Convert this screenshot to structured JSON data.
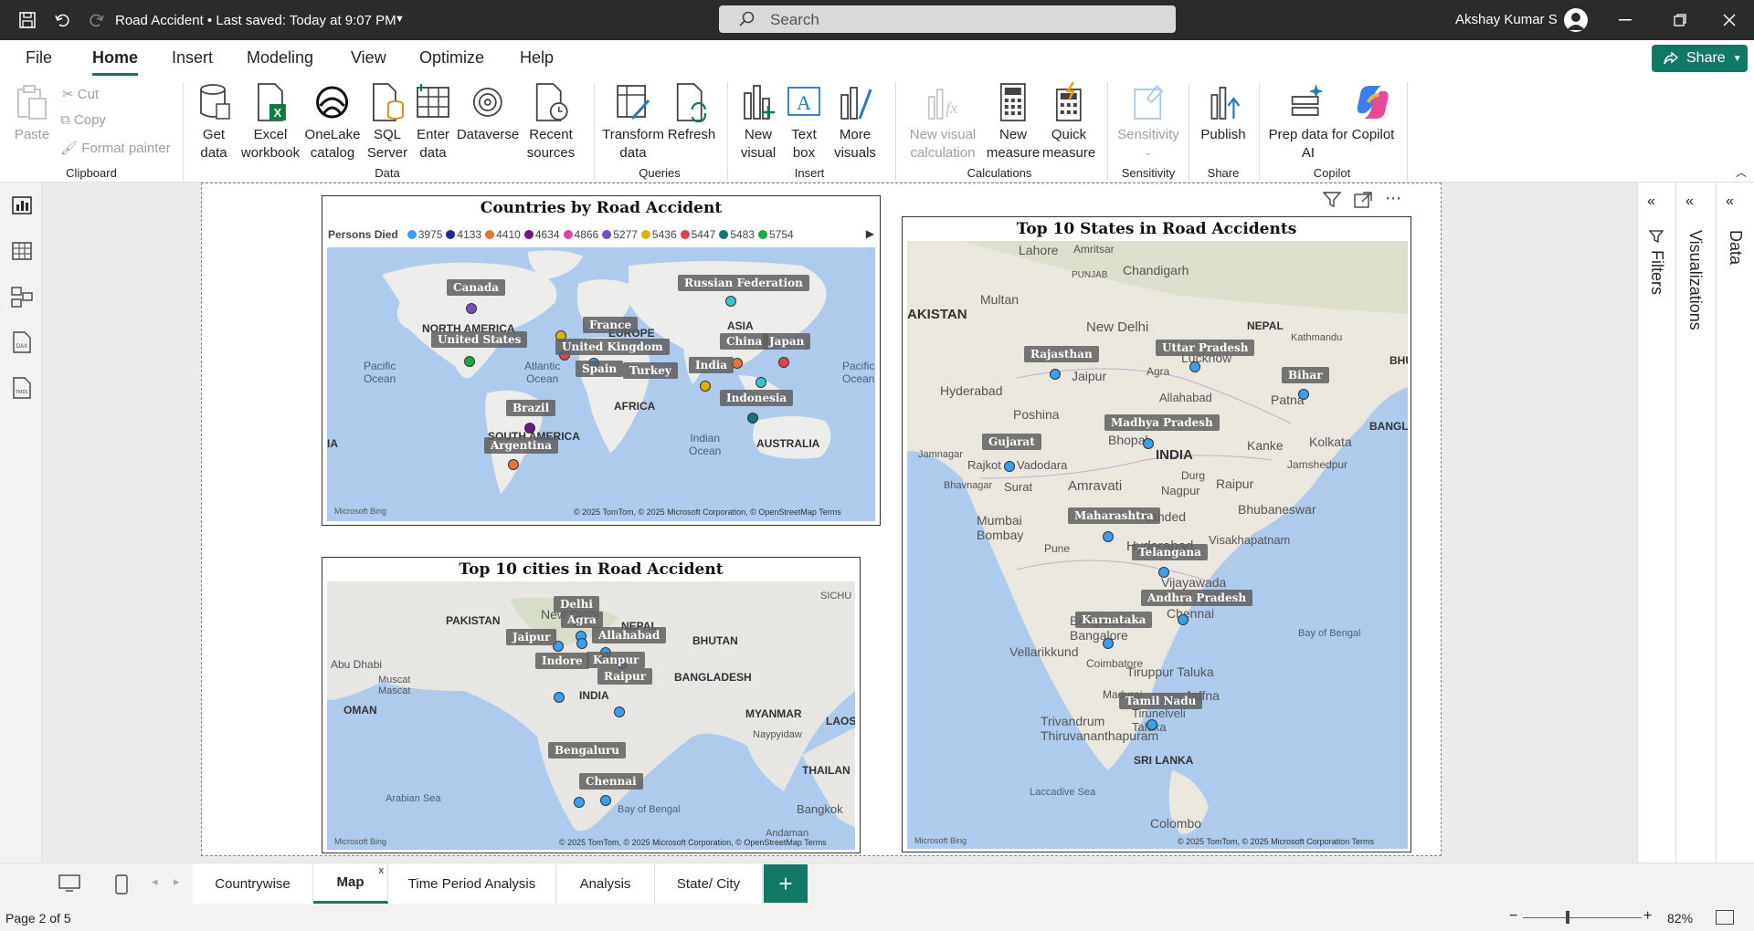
{
  "titlebar": {
    "doc_title": "Road Accident • Last saved: Today at 9:07 PM",
    "search_placeholder": "Search",
    "user_name": "Akshay Kumar S"
  },
  "menu": {
    "tabs": [
      "File",
      "Home",
      "Insert",
      "Modeling",
      "View",
      "Optimize",
      "Help"
    ],
    "active": "Home",
    "share_label": "Share"
  },
  "ribbon": {
    "clipboard": {
      "paste": "Paste",
      "cut": "Cut",
      "copy": "Copy",
      "format_painter": "Format painter",
      "group": "Clipboard"
    },
    "data": {
      "get_data": "Get\ndata",
      "excel": "Excel\nworkbook",
      "onelake": "OneLake\ncatalog",
      "sql": "SQL\nServer",
      "enter": "Enter\ndata",
      "dataverse": "Dataverse",
      "recent": "Recent\nsources",
      "group": "Data"
    },
    "queries": {
      "transform": "Transform\ndata",
      "refresh": "Refresh",
      "group": "Queries"
    },
    "insert": {
      "new_visual": "New\nvisual",
      "text_box": "Text\nbox",
      "more_visuals": "More\nvisuals",
      "group": "Insert"
    },
    "calculations": {
      "new_visual_calc": "New visual\ncalculation",
      "new_measure": "New\nmeasure",
      "quick_measure": "Quick\nmeasure",
      "group": "Calculations"
    },
    "sensitivity": {
      "label": "Sensitivity",
      "group": "Sensitivity"
    },
    "share": {
      "publish": "Publish",
      "group": "Share"
    },
    "copilot": {
      "prep_data": "Prep data for\nAI",
      "copilot": "Copilot",
      "group": "Copilot"
    }
  },
  "visuals": {
    "countries": {
      "title": "Countries by Road Accident",
      "legend_title": "Persons Died",
      "legend": [
        {
          "label": "3975",
          "color": "#3b9fef"
        },
        {
          "label": "4133",
          "color": "#1c2d8f"
        },
        {
          "label": "4410",
          "color": "#e8743b"
        },
        {
          "label": "4634",
          "color": "#6b1a7a"
        },
        {
          "label": "4866",
          "color": "#e044a7"
        },
        {
          "label": "5277",
          "color": "#744ec2"
        },
        {
          "label": "5436",
          "color": "#d9b300"
        },
        {
          "label": "5447",
          "color": "#d64550"
        },
        {
          "label": "5483",
          "color": "#197278"
        },
        {
          "label": "5754",
          "color": "#1aab40"
        }
      ],
      "labels": {
        "canada": "Canada",
        "us": "United States",
        "russia": "Russian Federation",
        "france": "France",
        "uk": "United Kingdom",
        "spain": "Spain",
        "turkey": "Turkey",
        "china": "China",
        "japan": "Japan",
        "india": "India",
        "indonesia": "Indonesia",
        "brazil": "Brazil",
        "argentina": "Argentina"
      },
      "geo": {
        "north_america": "NORTH AMERICA",
        "south_america": "SOUTH AMERICA",
        "europe": "EUROPE",
        "asia": "ASIA",
        "africa": "AFRICA",
        "australia": "AUSTRALIA",
        "ia": "IA",
        "pacific1": "Pacific\nOcean",
        "atlantic": "Atlantic\nOcean",
        "indian": "Indian\nOcean",
        "pacific2": "Pacific\nOcean"
      },
      "copyright": "© 2025 TomTom, © 2025 Microsoft Corporation, © OpenStreetMap  Terms",
      "bing": "Microsoft Bing"
    },
    "cities": {
      "title": "Top 10 cities in Road Accident",
      "labels": {
        "delhi": "Delhi",
        "agra": "Agra",
        "jaipur": "Jaipur",
        "allahabad": "Allahabad",
        "indore": "Indore",
        "kanpur": "Kanpur",
        "raipur": "Raipur",
        "bengaluru": "Bengaluru",
        "chennai": "Chennai"
      },
      "geo": {
        "pakistan": "PAKISTAN",
        "new_delhi": "New Delhi",
        "nepal": "NEPAL",
        "bhutan": "BHUTAN",
        "bangladesh": "BANGLADESH",
        "abu_dhabi": "Abu Dhabi",
        "muscat": "Muscat\nMascat",
        "oman": "OMAN",
        "india": "INDIA",
        "myanmar": "MYANMAR",
        "naypyidaw": "Naypyidaw",
        "laos": "LAOS",
        "thailand": "THAILAN",
        "arabian_sea": "Arabian Sea",
        "bay_of_bengal": "Bay of Bengal",
        "bangkok": "Bangkok",
        "andaman": "Andaman",
        "sichu": "SICHU"
      },
      "copyright": "© 2025 TomTom, © 2025 Microsoft Corporation, © OpenStreetMap  Terms",
      "bing": "Microsoft Bing"
    },
    "states": {
      "title": "Top 10 States in Road Accidents",
      "labels": {
        "rajasthan": "Rajasthan",
        "uttar_pradesh": "Uttar Pradesh",
        "bihar": "Bihar",
        "madhya_pradesh": "Madhya Pradesh",
        "gujarat": "Gujarat",
        "maharashtra": "Maharashtra",
        "telangana": "Telangana",
        "andhra_pradesh": "Andhra Pradesh",
        "karnataka": "Karnataka",
        "tamil_nadu": "Tamil Nadu"
      },
      "geo": {
        "akistan": "AKISTAN",
        "multan": "Multan",
        "lahore": "Lahore",
        "amritsar": "Amritsar",
        "chandigarh": "Chandigarh",
        "punjab": "PUNJAB",
        "new_delhi": "New Delhi",
        "nepal": "NEPAL",
        "kathmandu": "Kathmandu",
        "jaipur": "Jaipur",
        "hyderabad_pk": "Hyderabad",
        "lucknow": "Lucknow",
        "agra": "Agra",
        "patna": "Patna",
        "bhopal": "Bhopal",
        "india": "INDIA",
        "kanke": "Kanke",
        "kolkata": "Kolkata",
        "bangla": "BANGLA",
        "bhu": "BHU",
        "jamnagar": "Jamnagar",
        "rajkot": "Rajkot",
        "vadodara": "Vadodara",
        "surat": "Surat",
        "bhavnagar": "Bhavnagar",
        "nagpur": "Nagpur",
        "raipur": "Raipur",
        "bhubaneswar": "Bhubaneswar",
        "mumbai": "Mumbai\nBombay",
        "pune": "Pune",
        "nanded": "Nanded",
        "hyderabad": "Hyderabad",
        "visakhapatnam": "Visakhapatnam",
        "vijayawada": "Vijayawada",
        "chennai": "Chennai",
        "bengaluru": "Bengaluru\nBangalore",
        "bay_of_bengal": "Bay of Bengal",
        "vellarikkund": "Vellarikkund",
        "coimbatore": "Coimbatore",
        "tiruppur": "Tiruppur Taluka",
        "jaffna": "Jaffna",
        "madurai": "Madurai",
        "trivandrum": "Trivandrum\nThiruvananthapuram",
        "tirunelveli": "Tirunelveli\nTaluka",
        "sri_lanka": "SRI LANKA",
        "laccadive": "Laccadive Sea",
        "colombo": "Colombo",
        "poshina": "Poshina",
        "allahabad": "Allahabad",
        "durg": "Durg",
        "amravati": "Amravati",
        "jamshedpur": "Jamshedpur"
      },
      "copyright": "© 2025 TomTom, © 2025 Microsoft Corporation  Terms",
      "bing": "Microsoft Bing"
    }
  },
  "right_panes": {
    "filters": "Filters",
    "visualizations": "Visualizations",
    "data": "Data"
  },
  "page_tabs": {
    "tabs": [
      "Countrywise",
      "Map",
      "Time Period Analysis",
      "Analysis",
      "State/ City"
    ],
    "active": "Map",
    "close": "x",
    "add": "+"
  },
  "status": {
    "page_info": "Page 2 of 5",
    "zoom": "82%",
    "zoom_fraction": 0.38
  }
}
